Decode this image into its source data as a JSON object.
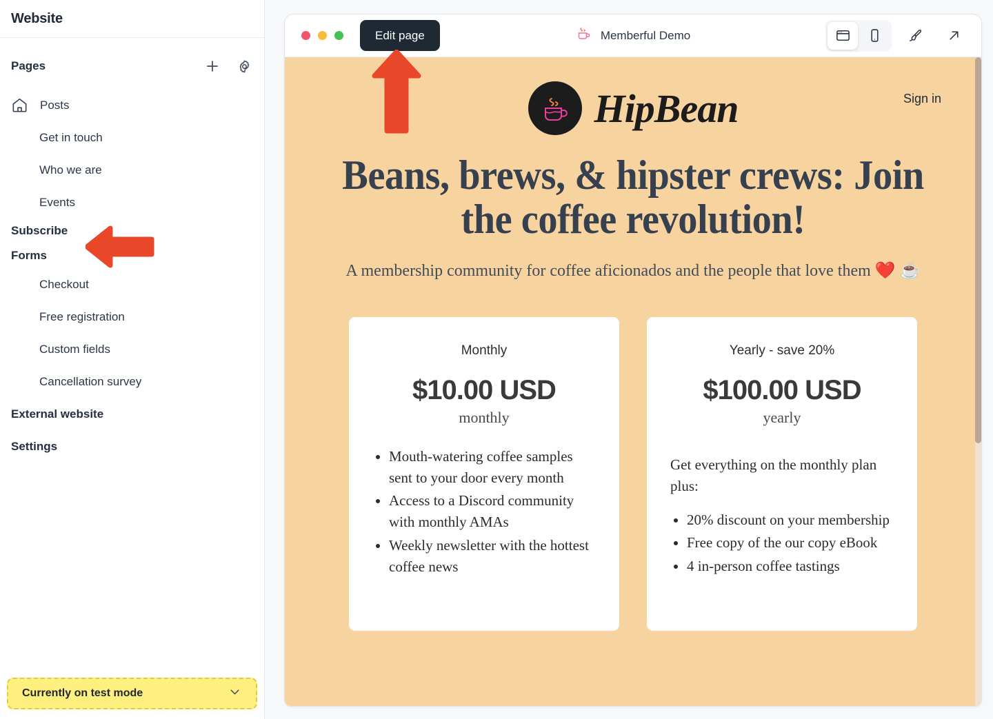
{
  "sidebar": {
    "title": "Website",
    "pages_label": "Pages",
    "add_icon": "plus-icon",
    "settings_icon": "gear-icon",
    "items": [
      {
        "label": "Posts",
        "icon": "home-icon",
        "level": "top"
      },
      {
        "label": "Get in touch",
        "level": "sub"
      },
      {
        "label": "Who we are",
        "level": "sub"
      },
      {
        "label": "Events",
        "level": "sub"
      },
      {
        "label": "Subscribe",
        "level": "group"
      },
      {
        "label": "Forms",
        "level": "group"
      },
      {
        "label": "Checkout",
        "level": "sub"
      },
      {
        "label": "Free registration",
        "level": "sub"
      },
      {
        "label": "Custom fields",
        "level": "sub"
      },
      {
        "label": "Cancellation survey",
        "level": "sub"
      },
      {
        "label": "External website",
        "level": "group"
      },
      {
        "label": "Settings",
        "level": "group"
      }
    ],
    "test_mode": {
      "label": "Currently on test mode",
      "chevron_icon": "chevron-down-icon",
      "bg": "#FDF07F",
      "border": "#E7C93C"
    }
  },
  "annotations": {
    "arrow_color": "#E8472A",
    "left_arrow_target": "Subscribe",
    "up_arrow_target": "Edit page"
  },
  "browser": {
    "traffic_lights": [
      "close-red",
      "minimize-yellow",
      "maximize-green"
    ],
    "edit_button": "Edit page",
    "site_title": "Memberful Demo",
    "site_icon": "coffee-cup-icon",
    "view_buttons": [
      {
        "name": "desktop-view",
        "active": true
      },
      {
        "name": "mobile-view",
        "active": false
      },
      {
        "name": "theme-brush",
        "active": false
      },
      {
        "name": "open-external",
        "active": false
      }
    ]
  },
  "site": {
    "brand": "HipBean",
    "logo_icon": "coffee-cup-logo",
    "signin": "Sign in",
    "background": "#F7D3A0",
    "heading": "Beans, brews, & hipster crews: Join the coffee revolution!",
    "subheading": "A membership community for coffee aficionados and the people that love them ❤️ ☕",
    "plans": [
      {
        "name": "Monthly",
        "price": "$10.00 USD",
        "period": "monthly",
        "intro": "",
        "features": [
          "Mouth-watering coffee samples sent to your door every month",
          "Access to a Discord community with monthly AMAs",
          "Weekly newsletter with the hottest coffee news"
        ]
      },
      {
        "name": "Yearly - save 20%",
        "price": "$100.00 USD",
        "period": "yearly",
        "intro": "Get everything on the monthly plan plus:",
        "features": [
          "20% discount on your membership",
          "Free copy of the our copy eBook",
          "4 in-person coffee tastings"
        ]
      }
    ]
  }
}
